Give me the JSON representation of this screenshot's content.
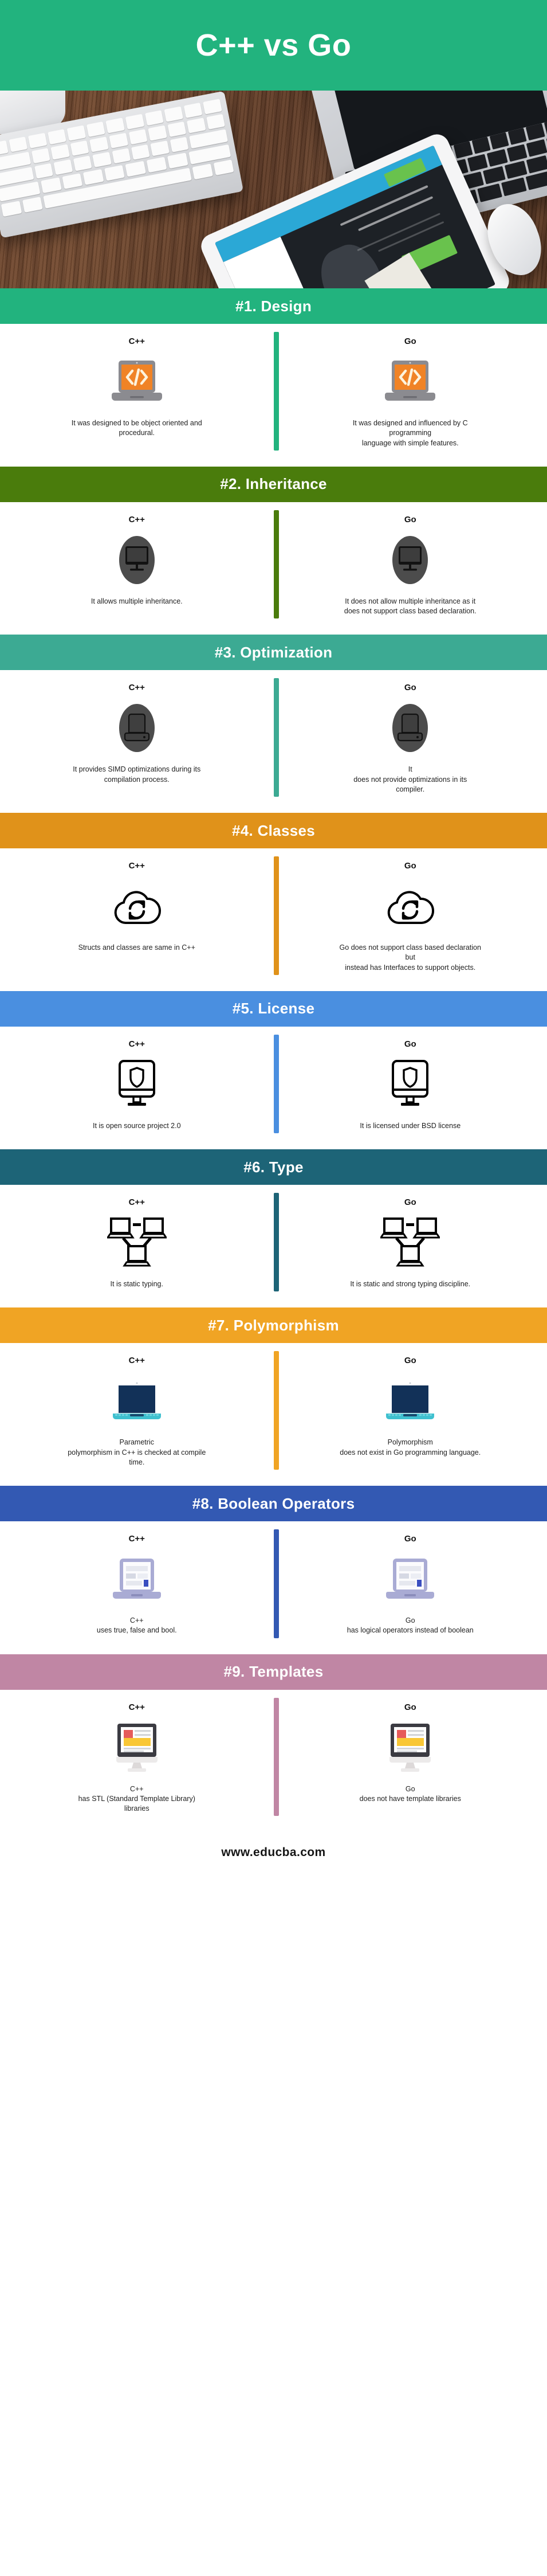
{
  "header": {
    "title": "C++ vs Go",
    "band_color": "#22b37e",
    "photo_alt": "desk-photo-keyboard-tablet-laptop-mouse"
  },
  "columns": {
    "left_label": "C++",
    "right_label": "Go"
  },
  "sections": [
    {
      "title": "#1. Design",
      "color": "#22b37e",
      "icon": "laptop-code-icon",
      "left": "It was designed to be object oriented and\nprocedural.",
      "right": "It was designed and influenced by C programming\nlanguage with simple features."
    },
    {
      "title": "#2. Inheritance",
      "color": "#4a7c0c",
      "icon": "monitor-circle-icon",
      "left": "It allows multiple inheritance.",
      "right": "It does not allow multiple inheritance as it\ndoes not support class based declaration."
    },
    {
      "title": "#3. Optimization",
      "color": "#3caa93",
      "icon": "laptop-circle-icon",
      "left": "It provides SIMD optimizations during its\ncompilation process.",
      "right": "It\ndoes not provide optimizations in its compiler."
    },
    {
      "title": "#4. Classes",
      "color": "#e0921a",
      "icon": "cloud-sync-icon",
      "left": "Structs and classes are same in C++",
      "right": "Go does not support class based declaration but\ninstead has Interfaces to support objects."
    },
    {
      "title": "#5. License",
      "color": "#4a8fe0",
      "icon": "monitor-shield-icon",
      "left": "It is open source project 2.0",
      "right": "It is licensed under BSD license"
    },
    {
      "title": "#6. Type",
      "color": "#1d6477",
      "icon": "network-nodes-icon",
      "left": "It is static typing.",
      "right": "It is static and strong typing discipline."
    },
    {
      "title": "#7. Polymorphism",
      "color": "#f0a424",
      "icon": "navy-laptop-icon",
      "left": "Parametric\npolymorphism in C++ is checked at compile time.",
      "right": "Polymorphism\ndoes not exist in Go programming language."
    },
    {
      "title": "#8. Boolean Operators",
      "color": "#3359b3",
      "icon": "laptop-webpage-icon",
      "left": "C++\nuses true, false and bool.",
      "right": "Go\nhas logical operators instead of boolean"
    },
    {
      "title": "#9. Templates",
      "color": "#c086a4",
      "icon": "monitor-article-icon",
      "left": "C++\nhas STL (Standard Template Library) libraries",
      "right": "Go\ndoes not have template libraries"
    }
  ],
  "footer": {
    "url": "www.educba.com"
  }
}
